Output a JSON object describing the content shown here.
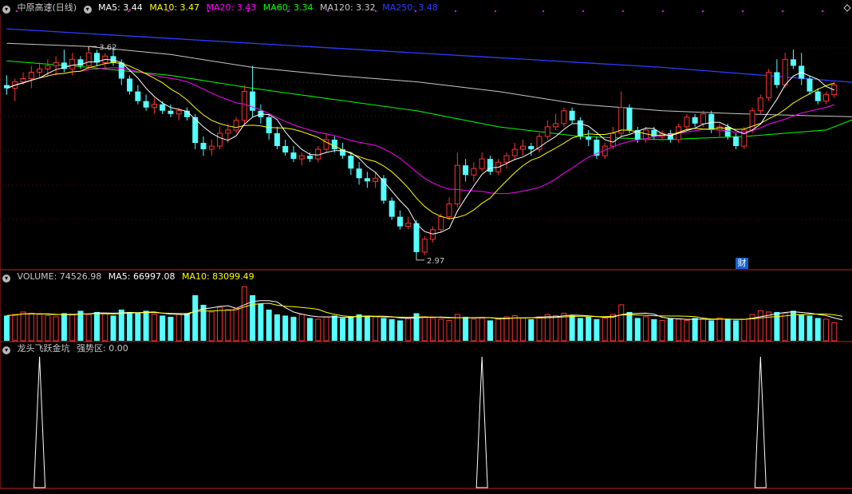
{
  "colors": {
    "background": "#000000",
    "up": "#ff3232",
    "down": "#54ffff",
    "frame": "#c81e1e",
    "grid": "#4a0f0f",
    "ma5": "#ffffff",
    "ma10": "#ffff00",
    "ma20": "#ff00ff",
    "ma60": "#00ff00",
    "ma120": "#c8c8c8",
    "ma250": "#2d3cff",
    "label": "#c8c8c8"
  },
  "price_panel": {
    "icon": "chevron-down-icon",
    "title": "中原高速(日线)",
    "ma5": "MA5: 3.44",
    "ma10": "MA10: 3.47",
    "ma20": "MA20: 3.43",
    "ma60": "MA60: 3.34",
    "ma120": "MA120: 3.32",
    "ma250": "MA250: 3.48",
    "high_label": "3.62",
    "low_label": "2.97",
    "fin_badge": "财"
  },
  "volume_panel": {
    "icon": "chevron-down-icon",
    "volume": "VOLUME: 74526.98",
    "ma5": "MA5: 66997.08",
    "ma10": "MA10: 83099.49"
  },
  "indicator_panel": {
    "icon": "chevron-down-icon",
    "title": "龙头飞跃金坑",
    "strong": "强势区: 0.00"
  },
  "chart_data": [
    {
      "type": "candlestick",
      "title": "中原高速(日线)",
      "ylim": [
        2.93,
        3.72
      ],
      "ohlc": [
        [
          3.5,
          3.53,
          3.47,
          3.49
        ],
        [
          3.49,
          3.52,
          3.45,
          3.51
        ],
        [
          3.51,
          3.54,
          3.5,
          3.52
        ],
        [
          3.52,
          3.56,
          3.49,
          3.54
        ],
        [
          3.54,
          3.57,
          3.52,
          3.55
        ],
        [
          3.55,
          3.58,
          3.53,
          3.56
        ],
        [
          3.56,
          3.59,
          3.53,
          3.57
        ],
        [
          3.57,
          3.61,
          3.54,
          3.55
        ],
        [
          3.55,
          3.6,
          3.53,
          3.58
        ],
        [
          3.58,
          3.59,
          3.55,
          3.56
        ],
        [
          3.56,
          3.62,
          3.55,
          3.6
        ],
        [
          3.6,
          3.61,
          3.56,
          3.57
        ],
        [
          3.57,
          3.6,
          3.55,
          3.59
        ],
        [
          3.59,
          3.62,
          3.56,
          3.57
        ],
        [
          3.57,
          3.58,
          3.5,
          3.52
        ],
        [
          3.52,
          3.53,
          3.47,
          3.48
        ],
        [
          3.48,
          3.5,
          3.44,
          3.45
        ],
        [
          3.45,
          3.47,
          3.42,
          3.43
        ],
        [
          3.43,
          3.46,
          3.41,
          3.44
        ],
        [
          3.44,
          3.45,
          3.41,
          3.42
        ],
        [
          3.42,
          3.44,
          3.4,
          3.41
        ],
        [
          3.41,
          3.43,
          3.39,
          3.42
        ],
        [
          3.42,
          3.43,
          3.39,
          3.4
        ],
        [
          3.4,
          3.41,
          3.3,
          3.32
        ],
        [
          3.32,
          3.34,
          3.28,
          3.3
        ],
        [
          3.3,
          3.33,
          3.28,
          3.31
        ],
        [
          3.31,
          3.37,
          3.3,
          3.35
        ],
        [
          3.35,
          3.38,
          3.32,
          3.36
        ],
        [
          3.36,
          3.4,
          3.35,
          3.39
        ],
        [
          3.39,
          3.5,
          3.38,
          3.48
        ],
        [
          3.48,
          3.56,
          3.4,
          3.42
        ],
        [
          3.42,
          3.44,
          3.38,
          3.4
        ],
        [
          3.4,
          3.41,
          3.33,
          3.35
        ],
        [
          3.35,
          3.37,
          3.3,
          3.31
        ],
        [
          3.31,
          3.33,
          3.28,
          3.29
        ],
        [
          3.29,
          3.31,
          3.26,
          3.27
        ],
        [
          3.27,
          3.29,
          3.25,
          3.28
        ],
        [
          3.28,
          3.29,
          3.26,
          3.27
        ],
        [
          3.27,
          3.31,
          3.26,
          3.3
        ],
        [
          3.3,
          3.35,
          3.29,
          3.33
        ],
        [
          3.33,
          3.34,
          3.29,
          3.3
        ],
        [
          3.3,
          3.32,
          3.27,
          3.28
        ],
        [
          3.28,
          3.29,
          3.22,
          3.24
        ],
        [
          3.24,
          3.26,
          3.19,
          3.21
        ],
        [
          3.21,
          3.23,
          3.18,
          3.2
        ],
        [
          3.2,
          3.23,
          3.18,
          3.21
        ],
        [
          3.21,
          3.22,
          3.13,
          3.14
        ],
        [
          3.14,
          3.15,
          3.08,
          3.09
        ],
        [
          3.09,
          3.11,
          3.05,
          3.06
        ],
        [
          3.06,
          3.09,
          3.05,
          3.07
        ],
        [
          3.07,
          3.08,
          2.97,
          2.98
        ],
        [
          2.98,
          3.03,
          2.97,
          3.02
        ],
        [
          3.02,
          3.06,
          3.01,
          3.05
        ],
        [
          3.05,
          3.1,
          3.04,
          3.09
        ],
        [
          3.09,
          3.15,
          3.08,
          3.13
        ],
        [
          3.13,
          3.29,
          3.12,
          3.25
        ],
        [
          3.25,
          3.27,
          3.2,
          3.22
        ],
        [
          3.22,
          3.26,
          3.2,
          3.24
        ],
        [
          3.24,
          3.29,
          3.23,
          3.27
        ],
        [
          3.27,
          3.28,
          3.22,
          3.23
        ],
        [
          3.23,
          3.27,
          3.22,
          3.26
        ],
        [
          3.26,
          3.29,
          3.24,
          3.28
        ],
        [
          3.28,
          3.32,
          3.27,
          3.3
        ],
        [
          3.3,
          3.33,
          3.28,
          3.31
        ],
        [
          3.31,
          3.32,
          3.28,
          3.3
        ],
        [
          3.3,
          3.35,
          3.29,
          3.34
        ],
        [
          3.34,
          3.39,
          3.33,
          3.37
        ],
        [
          3.37,
          3.41,
          3.36,
          3.38
        ],
        [
          3.38,
          3.43,
          3.37,
          3.42
        ],
        [
          3.42,
          3.43,
          3.38,
          3.39
        ],
        [
          3.39,
          3.4,
          3.33,
          3.34
        ],
        [
          3.34,
          3.36,
          3.31,
          3.33
        ],
        [
          3.33,
          3.34,
          3.27,
          3.28
        ],
        [
          3.28,
          3.32,
          3.27,
          3.31
        ],
        [
          3.31,
          3.37,
          3.3,
          3.35
        ],
        [
          3.35,
          3.48,
          3.34,
          3.43
        ],
        [
          3.43,
          3.44,
          3.35,
          3.36
        ],
        [
          3.36,
          3.37,
          3.32,
          3.33
        ],
        [
          3.33,
          3.37,
          3.32,
          3.36
        ],
        [
          3.36,
          3.37,
          3.33,
          3.34
        ],
        [
          3.34,
          3.36,
          3.33,
          3.35
        ],
        [
          3.35,
          3.36,
          3.32,
          3.33
        ],
        [
          3.33,
          3.38,
          3.32,
          3.37
        ],
        [
          3.37,
          3.41,
          3.36,
          3.4
        ],
        [
          3.4,
          3.41,
          3.37,
          3.38
        ],
        [
          3.38,
          3.42,
          3.37,
          3.41
        ],
        [
          3.41,
          3.42,
          3.35,
          3.36
        ],
        [
          3.36,
          3.38,
          3.34,
          3.37
        ],
        [
          3.37,
          3.38,
          3.33,
          3.34
        ],
        [
          3.34,
          3.35,
          3.3,
          3.31
        ],
        [
          3.31,
          3.37,
          3.3,
          3.36
        ],
        [
          3.36,
          3.43,
          3.35,
          3.42
        ],
        [
          3.42,
          3.47,
          3.41,
          3.46
        ],
        [
          3.46,
          3.55,
          3.45,
          3.54
        ],
        [
          3.54,
          3.58,
          3.49,
          3.5
        ],
        [
          3.5,
          3.6,
          3.49,
          3.58
        ],
        [
          3.58,
          3.61,
          3.55,
          3.56
        ],
        [
          3.56,
          3.6,
          3.5,
          3.52
        ],
        [
          3.52,
          3.53,
          3.47,
          3.48
        ],
        [
          3.48,
          3.49,
          3.44,
          3.45
        ],
        [
          3.45,
          3.48,
          3.44,
          3.47
        ],
        [
          3.47,
          3.51,
          3.46,
          3.5
        ]
      ],
      "series_labels": {
        "ma5": "MA5: 3.44",
        "ma10": "MA10: 3.47",
        "ma20": "MA20: 3.43",
        "ma60": "MA60: 3.34",
        "ma120": "MA120: 3.32",
        "ma250": "MA250: 3.48"
      },
      "ma250_path": [
        [
          0,
          3.675
        ],
        [
          20,
          3.645
        ],
        [
          40,
          3.615
        ],
        [
          60,
          3.585
        ],
        [
          80,
          3.555
        ],
        [
          100,
          3.515
        ],
        [
          105,
          3.505
        ]
      ],
      "ma120_path": [
        [
          0,
          3.63
        ],
        [
          10,
          3.62
        ],
        [
          20,
          3.595
        ],
        [
          30,
          3.555
        ],
        [
          40,
          3.53
        ],
        [
          50,
          3.51
        ],
        [
          60,
          3.48
        ],
        [
          70,
          3.44
        ],
        [
          80,
          3.42
        ],
        [
          90,
          3.41
        ],
        [
          105,
          3.4
        ]
      ],
      "ma60_path": [
        [
          0,
          3.575
        ],
        [
          10,
          3.555
        ],
        [
          20,
          3.53
        ],
        [
          30,
          3.49
        ],
        [
          40,
          3.455
        ],
        [
          50,
          3.42
        ],
        [
          60,
          3.37
        ],
        [
          70,
          3.34
        ],
        [
          80,
          3.33
        ],
        [
          90,
          3.34
        ],
        [
          100,
          3.36
        ],
        [
          105,
          3.41
        ]
      ],
      "annotations": {
        "high": "3.62",
        "low": "2.97"
      }
    },
    {
      "type": "bar",
      "title": "VOLUME",
      "values": [
        21000,
        22000,
        24000,
        23000,
        22000,
        21000,
        20000,
        23000,
        22000,
        25000,
        22000,
        24000,
        23000,
        21000,
        26000,
        24000,
        23000,
        25000,
        22000,
        21000,
        20000,
        22000,
        23000,
        38000,
        30000,
        24000,
        28000,
        26000,
        27000,
        45000,
        38000,
        31000,
        26000,
        22000,
        21000,
        20000,
        22000,
        19000,
        18000,
        20000,
        21000,
        19000,
        20000,
        22000,
        21000,
        20000,
        19000,
        18000,
        17000,
        19000,
        23000,
        20000,
        19000,
        18000,
        17000,
        22000,
        20000,
        18000,
        19000,
        17000,
        18000,
        20000,
        21000,
        19000,
        18000,
        20000,
        22000,
        21000,
        23000,
        21000,
        19000,
        20000,
        18000,
        19000,
        22000,
        30000,
        24000,
        19000,
        20000,
        18000,
        17000,
        19000,
        18000,
        17000,
        19000,
        18000,
        17000,
        19000,
        18000,
        17000,
        18000,
        22000,
        25000,
        24000,
        24000,
        23000,
        25000,
        22000,
        21000,
        19000,
        18000,
        15000,
        14000
      ],
      "series_labels": {
        "volume": "VOLUME: 74526.98",
        "ma5": "MA5: 66997.08",
        "ma10": "MA10: 83099.49"
      }
    },
    {
      "type": "line",
      "title": "龙头飞跃金坑",
      "series_labels": {
        "strong": "强势区: 0.00"
      },
      "spike_positions": [
        4,
        58,
        92
      ]
    }
  ]
}
